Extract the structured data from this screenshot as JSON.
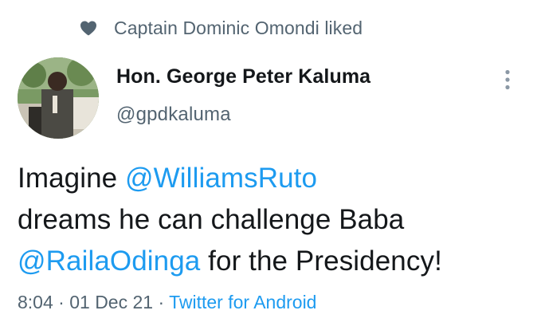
{
  "social_context": {
    "icon": "heart-icon",
    "text": "Captain Dominic Omondi liked"
  },
  "author": {
    "name": "Hon. George Peter Kaluma",
    "handle": "@gpdkaluma"
  },
  "tweet": {
    "line1_prefix": "Imagine ",
    "mention1": "@WilliamsRuto",
    "line2": "dreams he can challenge Baba",
    "mention2": "@RailaOdinga",
    "line3_suffix": " for the Presidency!"
  },
  "meta": {
    "time": "8:04",
    "separator1": " · ",
    "date": "01 Dec 21",
    "separator2": " · ",
    "source": "Twitter for Android"
  },
  "colors": {
    "text": "#14171a",
    "secondary": "#536471",
    "link": "#1d9bf0"
  }
}
